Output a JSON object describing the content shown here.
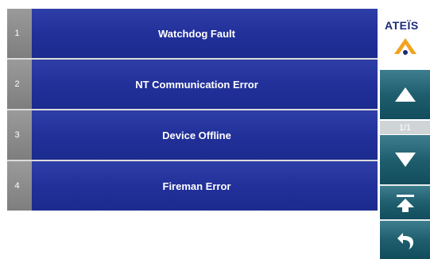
{
  "alarms": [
    {
      "number": "1",
      "label": "Watchdog Fault"
    },
    {
      "number": "2",
      "label": "NT Communication Error"
    },
    {
      "number": "3",
      "label": "Device Offline"
    },
    {
      "number": "4",
      "label": "Fireman Error"
    }
  ],
  "sidebar": {
    "brand": "ATEÏS",
    "page_indicator": "1/1",
    "buttons": [
      "arrow-up-icon",
      "arrow-down-icon",
      "jump-to-top-icon",
      "back-icon"
    ]
  },
  "colors": {
    "row_blue": "#22309a",
    "number_gray": "#8a8a8a",
    "sidebar_teal": "#1f5e6e",
    "logo_orange": "#f4a21c"
  }
}
